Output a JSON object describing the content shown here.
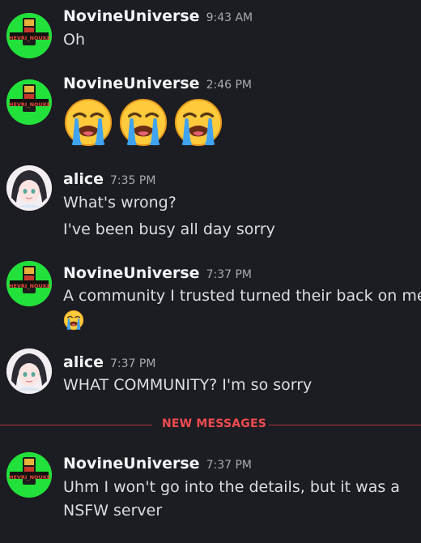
{
  "messages": [
    {
      "author": "NovineUniverse",
      "time": "9:43 AM",
      "lines": [
        "Oh"
      ]
    },
    {
      "author": "NovineUniverse",
      "time": "2:46 PM",
      "emoji": [
        "loudly-crying-face",
        "loudly-crying-face",
        "loudly-crying-face"
      ]
    },
    {
      "author": "alice",
      "time": "7:35 PM",
      "lines": [
        "What's wrong?",
        "I've been busy all day sorry"
      ]
    },
    {
      "author": "NovineUniverse",
      "time": "7:37 PM",
      "lines": [
        "A community I trusted turned their back on me"
      ],
      "emoji": [
        "loudly-crying-face"
      ]
    },
    {
      "author": "alice",
      "time": "7:37 PM",
      "lines": [
        "WHAT COMMUNITY? I'm so sorry"
      ]
    },
    {
      "author": "NovineUniverse",
      "time": "7:37 PM",
      "lines": [
        "Uhm I won't go into the details, but it was a",
        "NSFW server"
      ]
    }
  ],
  "divider": {
    "label": "NEW MESSAGES"
  },
  "avatar_text": {
    "novine": "HEVRI_NOUKE"
  },
  "colors": {
    "background": "#1c1d22",
    "divider": "#f04b50",
    "novine_avatar": "#22e13a"
  }
}
